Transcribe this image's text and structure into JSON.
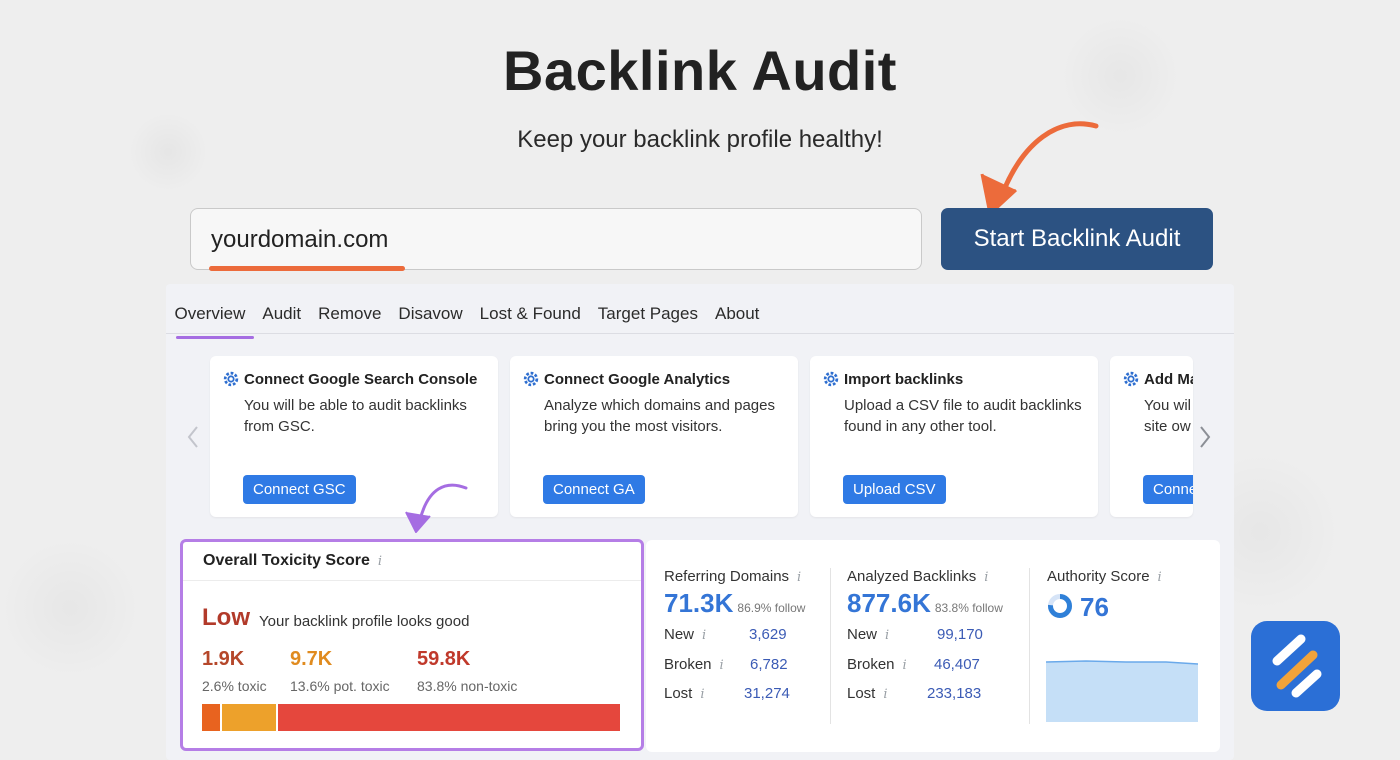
{
  "header": {
    "title": "Backlink Audit",
    "subtitle": "Keep your backlink profile healthy!"
  },
  "search": {
    "value": "yourdomain.com",
    "button_label": "Start Backlink Audit"
  },
  "tabs": [
    {
      "label": "Overview",
      "active": true
    },
    {
      "label": "Audit"
    },
    {
      "label": "Remove"
    },
    {
      "label": "Disavow"
    },
    {
      "label": "Lost & Found"
    },
    {
      "label": "Target Pages"
    },
    {
      "label": "About"
    }
  ],
  "cards": [
    {
      "title": "Connect Google Search Console",
      "desc": "You will be able to audit backlinks from GSC.",
      "button": "Connect GSC"
    },
    {
      "title": "Connect Google Analytics",
      "desc": "Analyze which domains and pages bring you the most visitors.",
      "button": "Connect GA"
    },
    {
      "title": "Import backlinks",
      "desc": "Upload a CSV file to audit backlinks found in any other tool.",
      "button": "Upload CSV"
    },
    {
      "title": "Add Ma",
      "desc": "You wil site ow",
      "button": "Conne"
    }
  ],
  "toxicity": {
    "title": "Overall Toxicity Score",
    "level": "Low",
    "description": "Your backlink profile looks good",
    "stats": [
      {
        "value": "1.9K",
        "label": "2.6% toxic",
        "color": "#b5472a"
      },
      {
        "value": "9.7K",
        "label": "13.6% pot. toxic",
        "color": "#e08b1f"
      },
      {
        "value": "59.8K",
        "label": "83.8% non-toxic",
        "color": "#c0392b"
      }
    ],
    "bar": [
      {
        "share": 2.6,
        "color": "#e8631f"
      },
      {
        "share": 13.6,
        "color": "#eda12b"
      },
      {
        "share": 83.8,
        "color": "#e5473d"
      }
    ]
  },
  "referring_domains": {
    "label": "Referring Domains",
    "value": "71.3K",
    "follow": "86.9% follow",
    "rows": [
      {
        "label": "New",
        "value": "3,629"
      },
      {
        "label": "Broken",
        "value": "6,782"
      },
      {
        "label": "Lost",
        "value": "31,274"
      }
    ]
  },
  "analyzed_backlinks": {
    "label": "Analyzed Backlinks",
    "value": "877.6K",
    "follow": "83.8% follow",
    "rows": [
      {
        "label": "New",
        "value": "99,170"
      },
      {
        "label": "Broken",
        "value": "46,407"
      },
      {
        "label": "Lost",
        "value": "233,183"
      }
    ]
  },
  "authority": {
    "label": "Authority Score",
    "value": "76",
    "score_fraction": 0.76
  },
  "colors": {
    "accent_orange": "#ec6b3b",
    "accent_purple": "#b57ee6",
    "primary_button": "#2c5282",
    "link_blue": "#3475d6"
  }
}
